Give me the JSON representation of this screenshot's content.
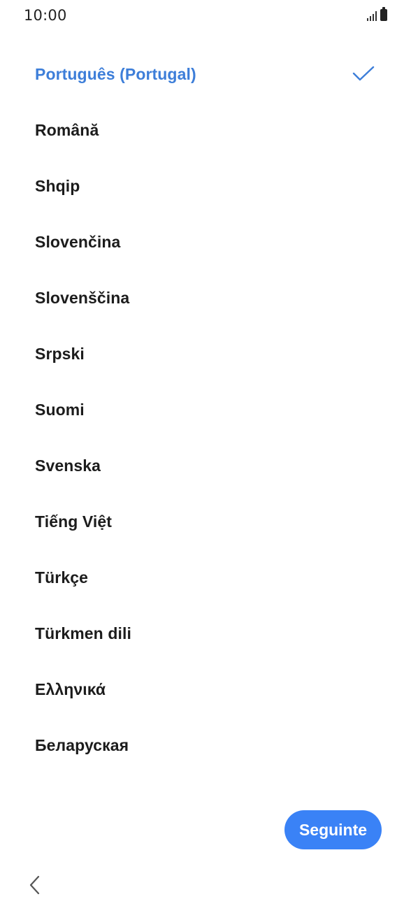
{
  "status_bar": {
    "time": "10:00"
  },
  "languages": [
    {
      "label": "Português (Portugal)",
      "selected": true
    },
    {
      "label": "Română",
      "selected": false
    },
    {
      "label": "Shqip",
      "selected": false
    },
    {
      "label": "Slovenčina",
      "selected": false
    },
    {
      "label": "Slovenščina",
      "selected": false
    },
    {
      "label": "Srpski",
      "selected": false
    },
    {
      "label": "Suomi",
      "selected": false
    },
    {
      "label": "Svenska",
      "selected": false
    },
    {
      "label": "Tiếng Việt",
      "selected": false
    },
    {
      "label": "Türkçe",
      "selected": false
    },
    {
      "label": "Türkmen dili",
      "selected": false
    },
    {
      "label": "Ελληνικά",
      "selected": false
    },
    {
      "label": "Беларуская",
      "selected": false
    }
  ],
  "next_button": {
    "label": "Seguinte"
  },
  "colors": {
    "accent": "#3d7ed9",
    "button": "#3a82f6"
  },
  "icons": {
    "check": "check-icon",
    "back": "chevron-left-icon",
    "signal": "signal-icon",
    "battery": "battery-icon"
  }
}
